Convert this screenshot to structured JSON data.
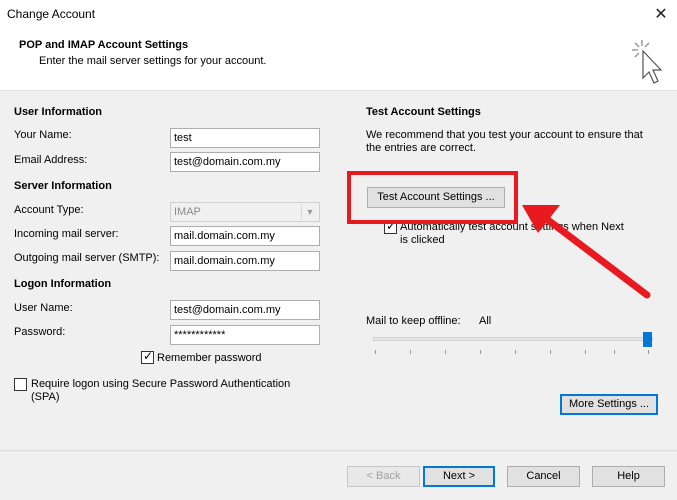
{
  "window": {
    "title": "Change Account",
    "close_glyph": "✕"
  },
  "header": {
    "title": "POP and IMAP Account Settings",
    "subtitle": "Enter the mail server settings for your account."
  },
  "user_info": {
    "heading": "User Information",
    "name_label": "Your Name:",
    "name_value": "test",
    "email_label": "Email Address:",
    "email_value": "test@domain.com.my"
  },
  "server_info": {
    "heading": "Server Information",
    "account_type_label": "Account Type:",
    "account_type_value": "IMAP",
    "incoming_label": "Incoming mail server:",
    "incoming_value": "mail.domain.com.my",
    "outgoing_label": "Outgoing mail server (SMTP):",
    "outgoing_value": "mail.domain.com.my"
  },
  "logon_info": {
    "heading": "Logon Information",
    "username_label": "User Name:",
    "username_value": "test@domain.com.my",
    "password_label": "Password:",
    "password_value": "************",
    "remember_label": "Remember password",
    "spa_label_1": "Require logon using Secure Password Authentication",
    "spa_label_2": "(SPA)"
  },
  "test_settings": {
    "heading": "Test Account Settings",
    "desc_1": "We recommend that you test your account to ensure that",
    "desc_2": "the entries are correct.",
    "button": "Test Account Settings ...",
    "auto_test_1": "Automatically test account settings when Next",
    "auto_test_2": "is clicked"
  },
  "offline": {
    "label": "Mail to keep offline:",
    "value": "All",
    "slider_level": 1.0
  },
  "buttons": {
    "more_settings": "More Settings ...",
    "back": "< Back",
    "next": "Next >",
    "cancel": "Cancel",
    "help": "Help"
  },
  "colors": {
    "accent": "#0078d7",
    "annotation": "#e8191f"
  }
}
